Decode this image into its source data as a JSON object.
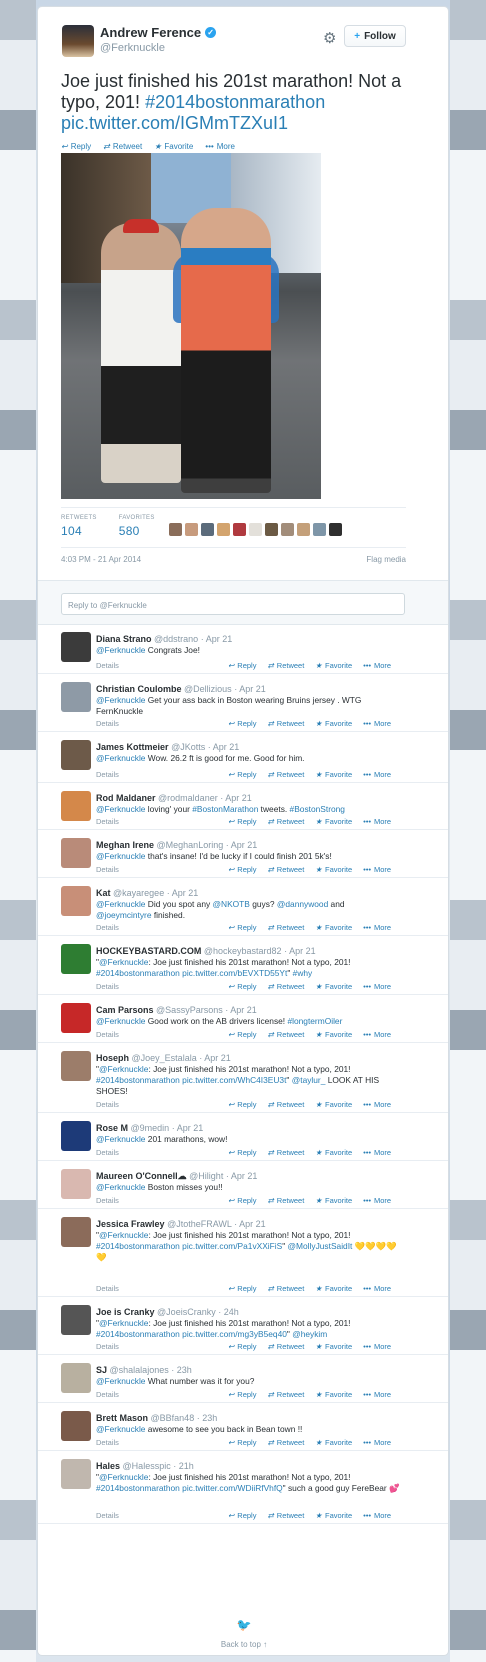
{
  "tweet": {
    "author_name": "Andrew Ference",
    "author_handle": "@Ferknuckle",
    "follow_label": "Follow",
    "text_plain": "Joe just finished his 201st marathon! Not a typo, 201! ",
    "hashtag": "#2014bostonmarathon",
    "link": "pic.twitter.com/IGMmTZXuI1",
    "actions": {
      "reply": "Reply",
      "retweet": "Retweet",
      "favorite": "Favorite",
      "more": "More"
    },
    "retweets_label": "RETWEETS",
    "retweets": "104",
    "favorites_label": "FAVORITES",
    "favorites": "580",
    "timestamp": "4:03 PM - 21 Apr 2014",
    "flag_media": "Flag media"
  },
  "reply_box": {
    "placeholder": "Reply to @Ferknuckle"
  },
  "colors": {
    "link": "#2a7fb5",
    "muted": "#8899a6",
    "verified": "#2aa3ef"
  },
  "replies": [
    {
      "name": "Diana Strano",
      "handle": "@ddstrano",
      "time": "Apr 21",
      "text": "@Ferknuckle Congrats Joe!"
    },
    {
      "name": "Christian Coulombe",
      "handle": "@Dellizious",
      "time": "Apr 21",
      "text": "@Ferknuckle Get your ass back in Boston wearing Bruins jersey . WTG FernKnuckle"
    },
    {
      "name": "James Kottmeier",
      "handle": "@JKotts",
      "time": "Apr 21",
      "text": "@Ferknuckle Wow. 26.2 ft is good for me. Good for him."
    },
    {
      "name": "Rod Maldaner",
      "handle": "@rodmaldaner",
      "time": "Apr 21",
      "text": "@Ferknuckle loving' your #BostonMarathon tweets. #BostonStrong"
    },
    {
      "name": "Meghan Irene",
      "handle": "@MeghanLoring",
      "time": "Apr 21",
      "text": "@Ferknuckle that's insane! I'd be lucky if I could finish 201 5k's!"
    },
    {
      "name": "Kat",
      "handle": "@kayaregee",
      "time": "Apr 21",
      "text": "@Ferknuckle Did you spot any @NKOTB guys? @dannywood and @joeymcintyre finished."
    },
    {
      "name": "HOCKEYBASTARD.COM",
      "handle": "@hockeybastard82",
      "time": "Apr 21",
      "text": "\"@Ferknuckle: Joe just finished his 201st marathon! Not a typo, 201! #2014bostonmarathon pic.twitter.com/bEVXTD55Yt\" #why"
    },
    {
      "name": "Cam Parsons",
      "handle": "@SassyParsons",
      "time": "Apr 21",
      "text": "@Ferknuckle Good work on the AB drivers license! #longtermOiler"
    },
    {
      "name": "Hoseph",
      "handle": "@Joey_Estalala",
      "time": "Apr 21",
      "text": "\"@Ferknuckle: Joe just finished his 201st marathon! Not a typo, 201! #2014bostonmarathon pic.twitter.com/WhC4I3EU3t\" @taylur_ LOOK AT HIS SHOES!"
    },
    {
      "name": "Rose M",
      "handle": "@9medin",
      "time": "Apr 21",
      "text": "@Ferknuckle 201 marathons, wow!"
    },
    {
      "name": "Maureen O'Connell☁",
      "handle": "@Hilight",
      "time": "Apr 21",
      "text": "@Ferknuckle Boston misses you!!"
    },
    {
      "name": "Jessica Frawley",
      "handle": "@JtotheFRAWL",
      "time": "Apr 21",
      "text": "\"@Ferknuckle: Joe just finished his 201st marathon! Not a typo, 201! #2014bostonmarathon pic.twitter.com/Pa1vXXiFiS\" @MollyJustSaidIt 💛💛💛💛 💛"
    },
    {
      "name": "Joe is Cranky",
      "handle": "@JoeisCranky",
      "time": "24h",
      "text": "\"@Ferknuckle: Joe just finished his 201st marathon! Not a typo, 201! #2014bostonmarathon pic.twitter.com/mg3yB5eq40\" @heykim"
    },
    {
      "name": "SJ",
      "handle": "@shalalajones",
      "time": "23h",
      "text": "@Ferknuckle What number was it for you?"
    },
    {
      "name": "Brett Mason",
      "handle": "@BBfan48",
      "time": "23h",
      "text": "@Ferknuckle awesome to see you back in Bean town !!"
    },
    {
      "name": "Hales",
      "handle": "@Halesspic",
      "time": "21h",
      "text": "\"@Ferknuckle: Joe just finished his 201st marathon! Not a typo, 201! #2014bostonmarathon pic.twitter.com/WDiiRfVhfQ\" such a good guy FereBear 💕"
    }
  ],
  "reply_labels": {
    "details": "Details",
    "reply": "Reply",
    "retweet": "Retweet",
    "favorite": "Favorite",
    "more": "More"
  },
  "footer": {
    "back_to_top": "Back to top ↑"
  }
}
